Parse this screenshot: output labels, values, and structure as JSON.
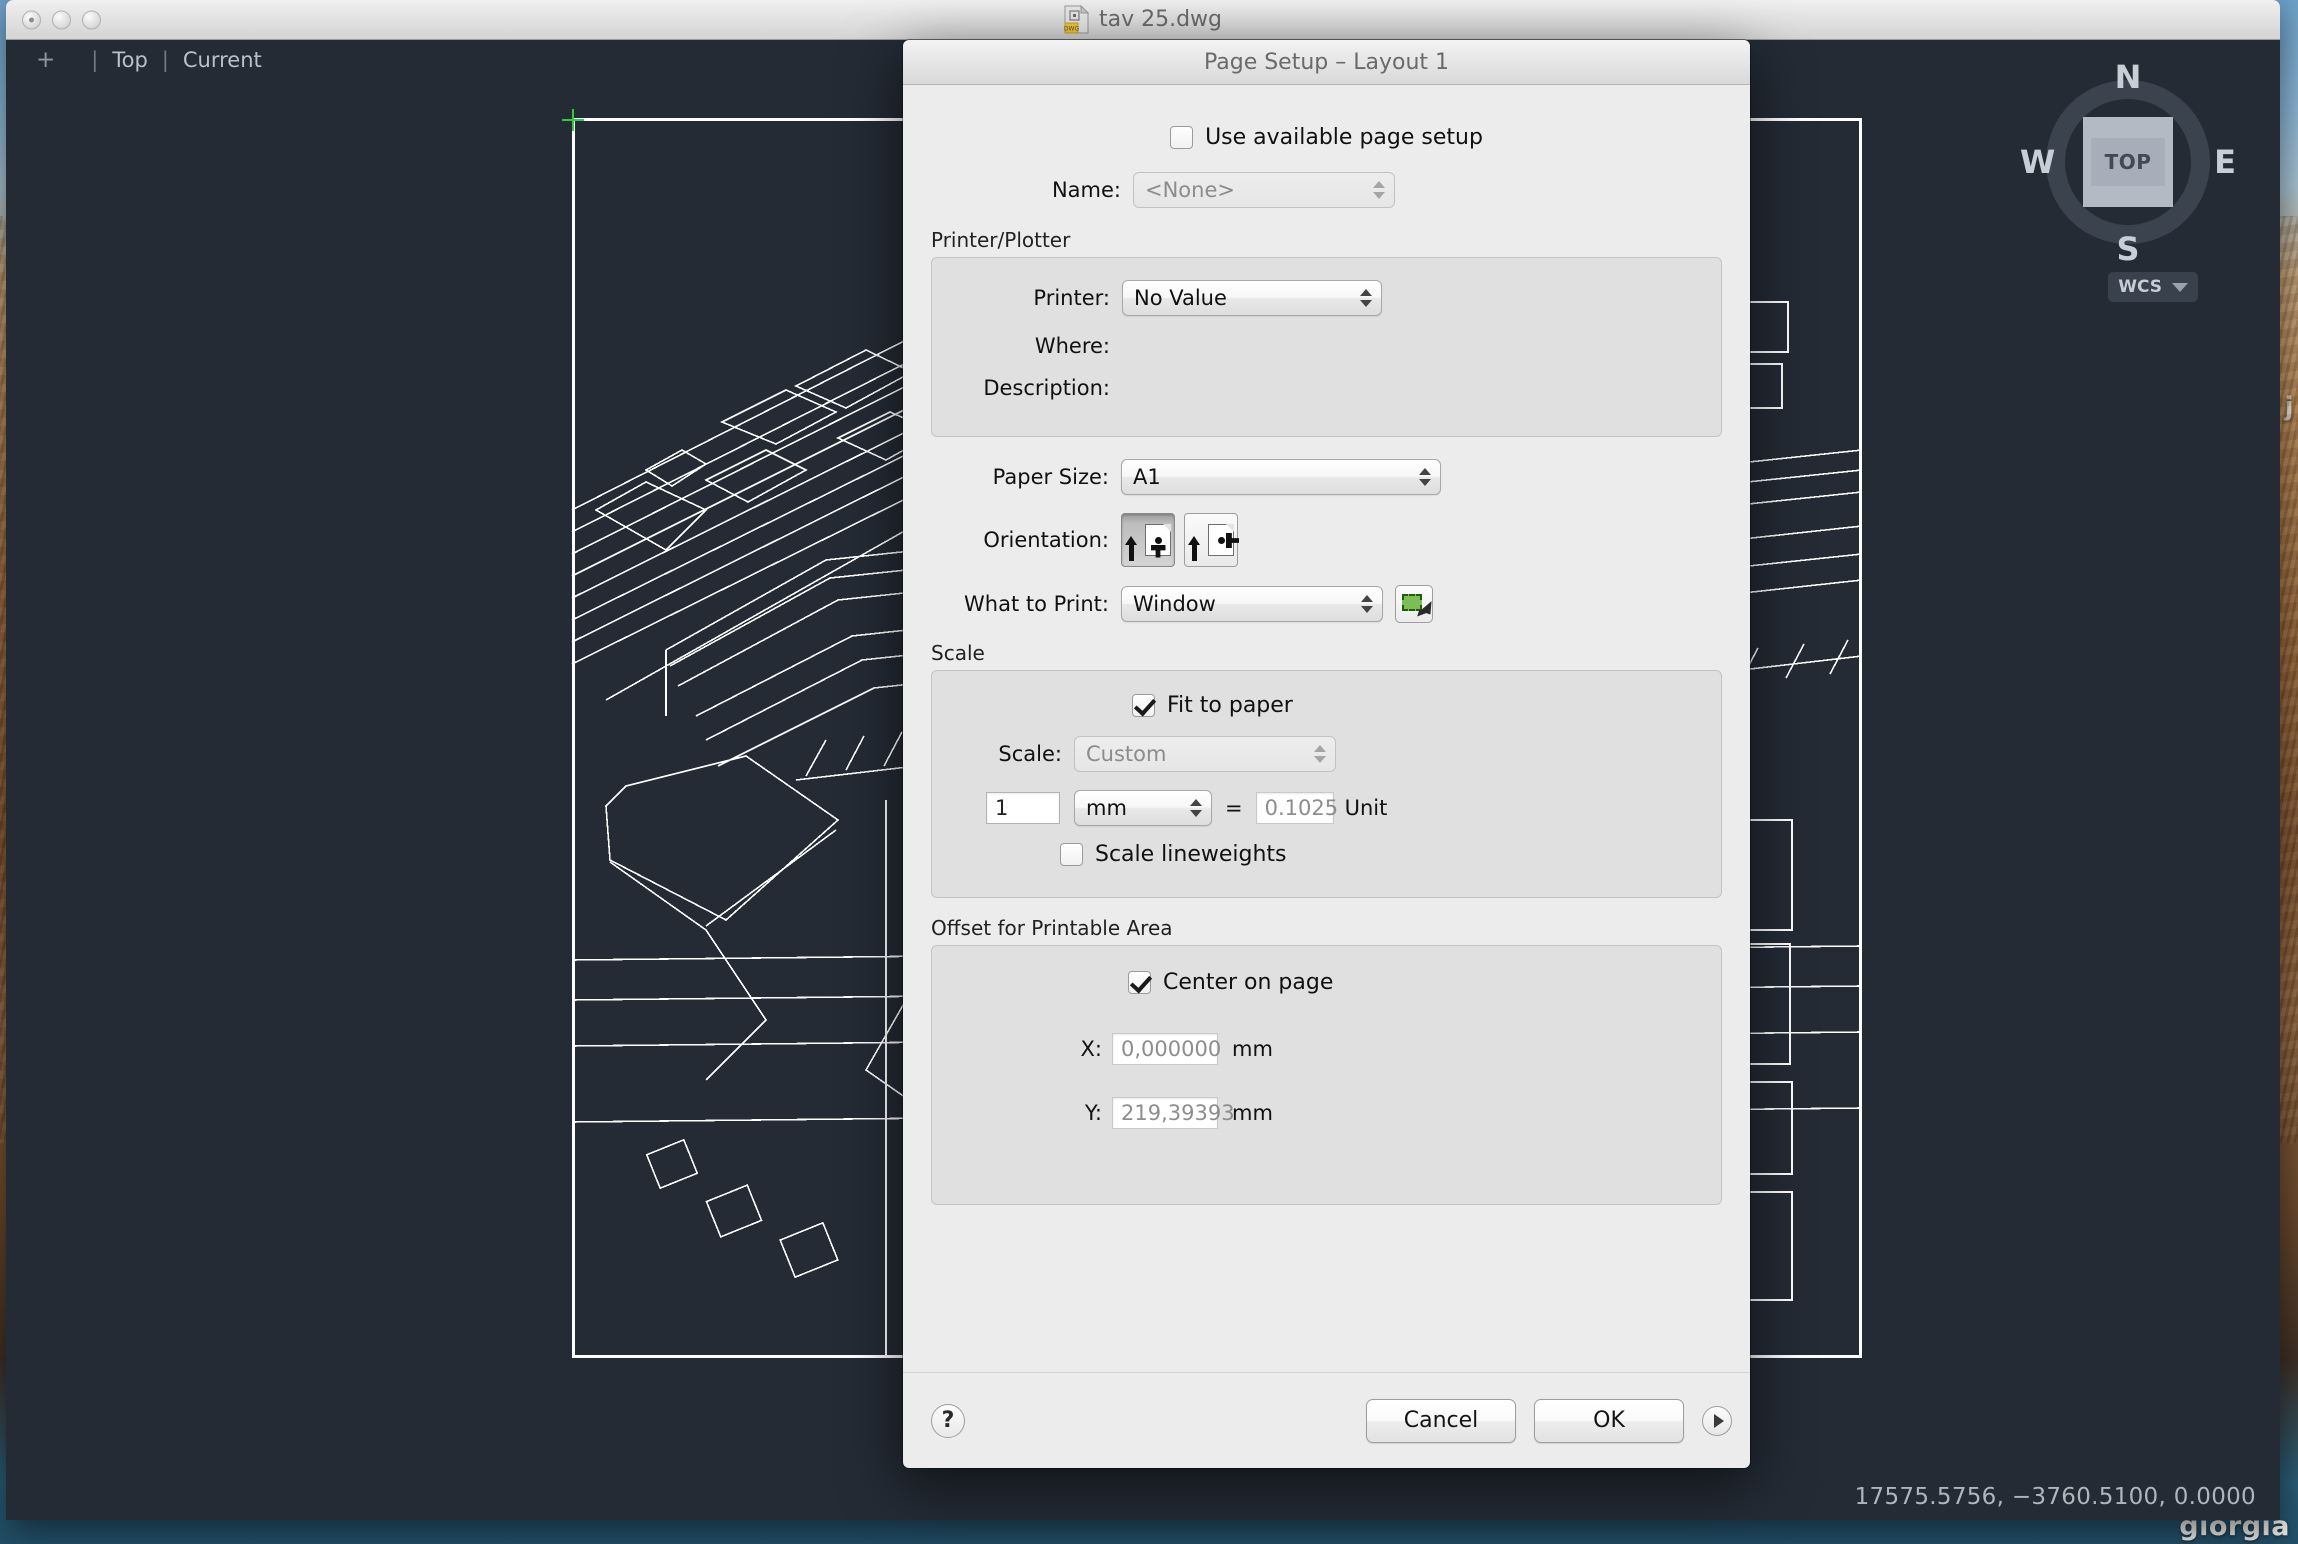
{
  "desktop": {
    "wallpaper_text_right": "j",
    "wallpaper_text_bottom": "giorgia"
  },
  "app": {
    "window_title": "tav 25.dwg",
    "file_icon": "dwg-file-icon",
    "viewport_bar": {
      "add": "+",
      "sep": "|",
      "view": "Top",
      "visual_style": "Current"
    },
    "viewcube": {
      "north": "N",
      "south": "S",
      "west": "W",
      "east": "E",
      "face": "TOP",
      "ucs_label": "WCS"
    },
    "status": {
      "coordinates": "17575.5756, −3760.5100, 0.0000"
    }
  },
  "dialog": {
    "title": "Page Setup – Layout 1",
    "use_available_page_setup": {
      "label": "Use available page setup",
      "checked": false
    },
    "name": {
      "label": "Name:",
      "value": "<None>",
      "disabled": true
    },
    "printer_plotter": {
      "group_title": "Printer/Plotter",
      "printer_label": "Printer:",
      "printer_value": "No Value",
      "where_label": "Where:",
      "where_value": "",
      "description_label": "Description:",
      "description_value": ""
    },
    "paper_size": {
      "label": "Paper Size:",
      "value": "A1"
    },
    "orientation": {
      "label": "Orientation:",
      "portrait_icon": "page-portrait-icon",
      "landscape_icon": "page-landscape-icon",
      "selected": "portrait"
    },
    "what_to_print": {
      "label": "What to Print:",
      "value": "Window",
      "pick_icon": "select-window-icon"
    },
    "scale": {
      "group_title": "Scale",
      "fit_to_paper": {
        "label": "Fit to paper",
        "checked": true
      },
      "scale_label": "Scale:",
      "scale_value": "Custom",
      "scale_disabled": true,
      "numerator": "1",
      "unit_select": "mm",
      "equals": "=",
      "denominator": "0.1025",
      "unit_label": "Unit",
      "scale_lineweights": {
        "label": "Scale lineweights",
        "checked": false
      }
    },
    "offset": {
      "group_title": "Offset for Printable Area",
      "center_on_page": {
        "label": "Center on page",
        "checked": true
      },
      "x_label": "X:",
      "x_value": "0,000000",
      "x_unit": "mm",
      "y_label": "Y:",
      "y_value": "219,39393",
      "y_unit": "mm"
    },
    "footer": {
      "help_label": "?",
      "cancel_label": "Cancel",
      "ok_label": "OK",
      "expand_icon": "expand-arrow-icon"
    }
  },
  "colors": {
    "canvas_bg": "#242b35",
    "drawing_line": "#ffffff",
    "marker_green": "#2ecc40",
    "dialog_bg": "#ececec",
    "group_bg": "#e0e0e0"
  }
}
